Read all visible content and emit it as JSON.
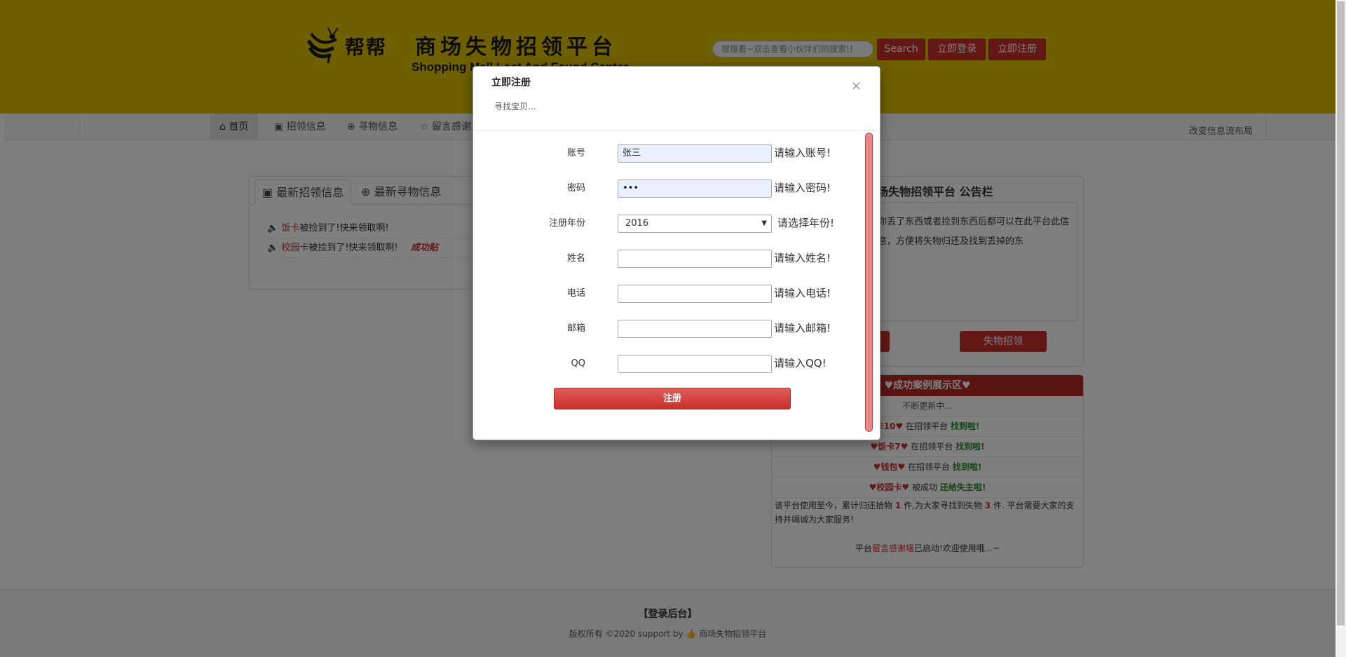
{
  "header": {
    "logo_bb": "帮帮",
    "logo_title": "商场失物招领平台",
    "logo_sub": "Shopping Mall Lost And Found Center",
    "search_placeholder": "搜搜看~双击查看小伙伴们的搜索!!",
    "search_button": "Search",
    "login_button": "立即登录",
    "register_button": "立即注册",
    "brand_color": "#ddc000",
    "accent_color": "#c9302c"
  },
  "nav": {
    "items": [
      {
        "label": "首页",
        "icon": "home-icon"
      },
      {
        "label": "招领信息",
        "icon": "image-icon"
      },
      {
        "label": "寻物信息",
        "icon": "zoom-icon"
      },
      {
        "label": "留言感谢",
        "icon": "star-icon"
      }
    ],
    "layout_toggle": "改变信息流布局"
  },
  "left_panel": {
    "tabs": [
      {
        "label": "最新招领信息",
        "icon": "image-icon"
      },
      {
        "label": "最新寻物信息",
        "icon": "zoom-icon"
      }
    ],
    "notices": [
      {
        "item": "饭卡",
        "text": "被捡到了!快来领取啊!",
        "badge": ""
      },
      {
        "item": "校园卡",
        "text": "被捡到了!快来领取啊!",
        "badge": "成功贴"
      }
    ]
  },
  "board": {
    "title": "场失物招领平台 公告栏",
    "text": "你丢了东西或者捡到东西后都可以在此平台此信息，方便将失物归还及找到丢掉的东",
    "button_right": "失物招领"
  },
  "cases": {
    "title": "♥成功案例展示区♥",
    "subtitle": "不断更新中...",
    "rows": [
      {
        "item": "卡10♥",
        "middle": "在招领平台",
        "status": "找到啦!"
      },
      {
        "item": "♥饭卡7♥",
        "middle": "在招领平台",
        "status": "找到啦!"
      },
      {
        "item": "♥钱包♥",
        "middle": "在招领平台",
        "status": "找到啦!"
      },
      {
        "item": "♥校园卡♥",
        "middle": "被成功",
        "status": "还给失主啦!"
      }
    ],
    "summary_a": "该平台使用至今，累计归还拾物",
    "summary_count_a": "1",
    "summary_b": "件,为大家寻找到失物",
    "summary_count_b": "3",
    "summary_c": "件. 平台需要大家的支持并竭诚为大家服务!",
    "foot_a": "平台",
    "foot_link": "留言感谢墙",
    "foot_b": "已启动!欢迎使用哦...~"
  },
  "footer": {
    "admin_link": "【登录后台】",
    "copyright": "版权所有 ©2020 support by",
    "copyright_brand": "商场失物招领平台"
  },
  "modal": {
    "title": "立即注册",
    "subtitle": "寻找宝贝...",
    "close": "×",
    "fields": [
      {
        "label": "账号",
        "value": "张三",
        "hint": "请输入账号!",
        "filled": true
      },
      {
        "label": "密码",
        "value": "•••",
        "hint": "请输入密码!",
        "filled": true
      },
      {
        "label": "注册年份",
        "value": "2016",
        "hint": "请选择年份!",
        "select": true
      },
      {
        "label": "姓名",
        "value": "",
        "hint": "请输入姓名!"
      },
      {
        "label": "电话",
        "value": "",
        "hint": "请输入电话!"
      },
      {
        "label": "邮箱",
        "value": "",
        "hint": "请输入邮箱!"
      },
      {
        "label": "QQ",
        "value": "",
        "hint": "请输入QQ!"
      }
    ],
    "submit": "注册"
  }
}
